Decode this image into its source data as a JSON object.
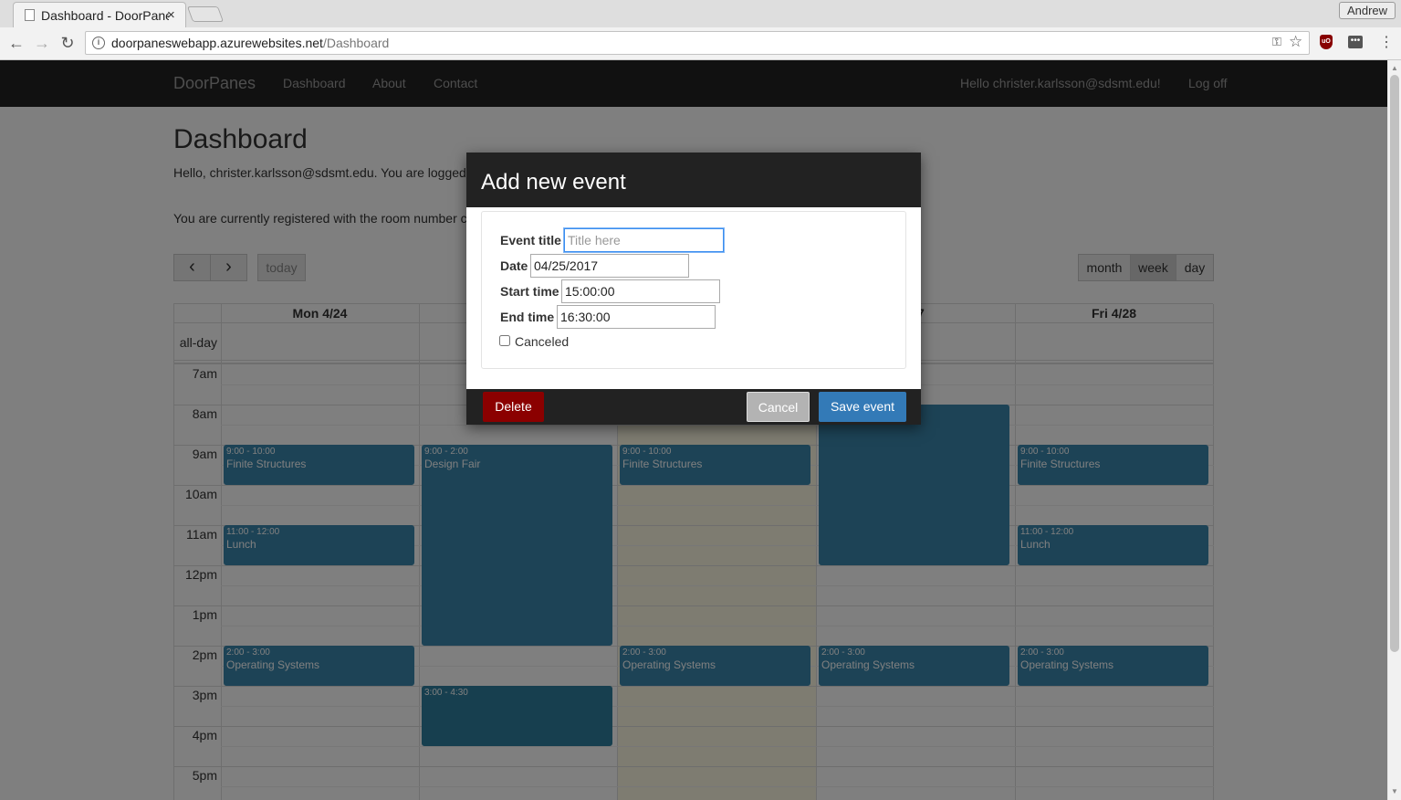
{
  "browser": {
    "tab_title": "Dashboard - DoorPanes",
    "tab_close": "×",
    "profile_name": "Andrew",
    "url_host": "doorpaneswebapp.azurewebsites.net",
    "url_path": "/Dashboard",
    "back": "←",
    "forward": "→",
    "reload": "↻",
    "info": "i",
    "star": "☆",
    "key": "⚿",
    "ublock": "uO",
    "dots": "•••",
    "menu": "⋮"
  },
  "site_nav": {
    "brand": "DoorPanes",
    "links": [
      "Dashboard",
      "About",
      "Contact"
    ],
    "greeting": "Hello christer.karlsson@sdsmt.edu!",
    "logoff": "Log off"
  },
  "page": {
    "title": "Dashboard",
    "hello_line": "Hello, christer.karlsson@sdsmt.edu. You are logged",
    "room_line": "You are currently registered with the room number c"
  },
  "calendar": {
    "prev": "‹",
    "next": "›",
    "today": "today",
    "views": [
      "month",
      "week",
      "day"
    ],
    "active_view": "week",
    "all_day": "all-day",
    "headers": [
      "Mon 4/24",
      "",
      "",
      "/27",
      "Fri 4/28"
    ],
    "times": [
      "7am",
      "8am",
      "9am",
      "10am",
      "11am",
      "12pm",
      "1pm",
      "2pm",
      "3pm",
      "4pm",
      "5pm"
    ],
    "events": [
      {
        "time": "9:00 - 10:00",
        "name": "Finite Structures"
      },
      {
        "time": "11:00 - 12:00",
        "name": "Lunch"
      },
      {
        "time": "2:00 - 3:00",
        "name": "Operating Systems"
      },
      {
        "time": "9:00 - 2:00",
        "name": "Design Fair"
      },
      {
        "time": "3:00 - 4:30",
        "name": ""
      },
      {
        "time": "9:00 - 10:00",
        "name": "Finite Structures"
      },
      {
        "time": "2:00 - 3:00",
        "name": "Operating Systems"
      },
      {
        "time": "",
        "name": ""
      },
      {
        "time": "2:00 - 3:00",
        "name": "Operating Systems"
      },
      {
        "time": "9:00 - 10:00",
        "name": "Finite Structures"
      },
      {
        "time": "11:00 - 12:00",
        "name": "Lunch"
      },
      {
        "time": "2:00 - 3:00",
        "name": "Operating Systems"
      }
    ]
  },
  "modal": {
    "title": "Add new event",
    "event_title_label": "Event title",
    "event_title_placeholder": "Title here",
    "date_label": "Date",
    "date_value": "04/25/2017",
    "start_label": "Start time",
    "start_value": "15:00:00",
    "end_label": "End time",
    "end_value": "16:30:00",
    "canceled_label": "Canceled",
    "delete": "Delete",
    "cancel": "Cancel",
    "save": "Save event",
    "colors": {
      "delete": "#8b0000",
      "cancel": "#b3b3b3",
      "save": "#337ab7"
    }
  }
}
